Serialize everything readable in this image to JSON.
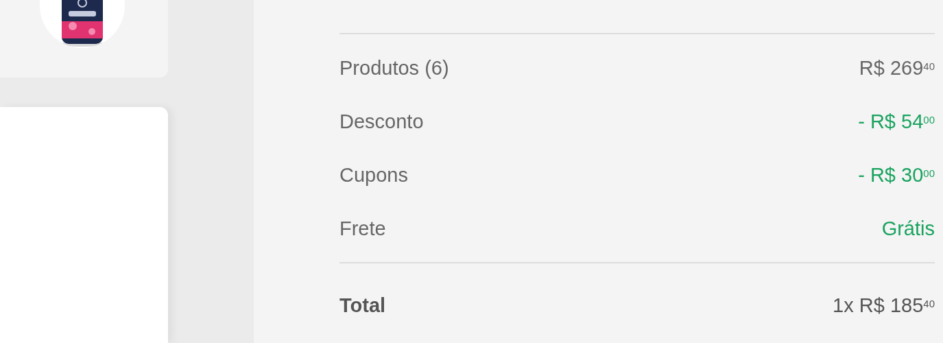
{
  "summary": {
    "rows": [
      {
        "label": "Produtos (6)",
        "value": "R$ 269$^{40}$",
        "kind": "normal"
      },
      {
        "label": "Desconto",
        "value": "- R$ 54$^{00}$",
        "kind": "discount"
      },
      {
        "label": "Cupons",
        "value": "- R$ 30$^{00}$",
        "kind": "discount"
      },
      {
        "label": "Frete",
        "value": "Grátis",
        "kind": "discount"
      }
    ],
    "total": {
      "label": "Total",
      "value": "1x R$ 185$^{40}$"
    }
  }
}
